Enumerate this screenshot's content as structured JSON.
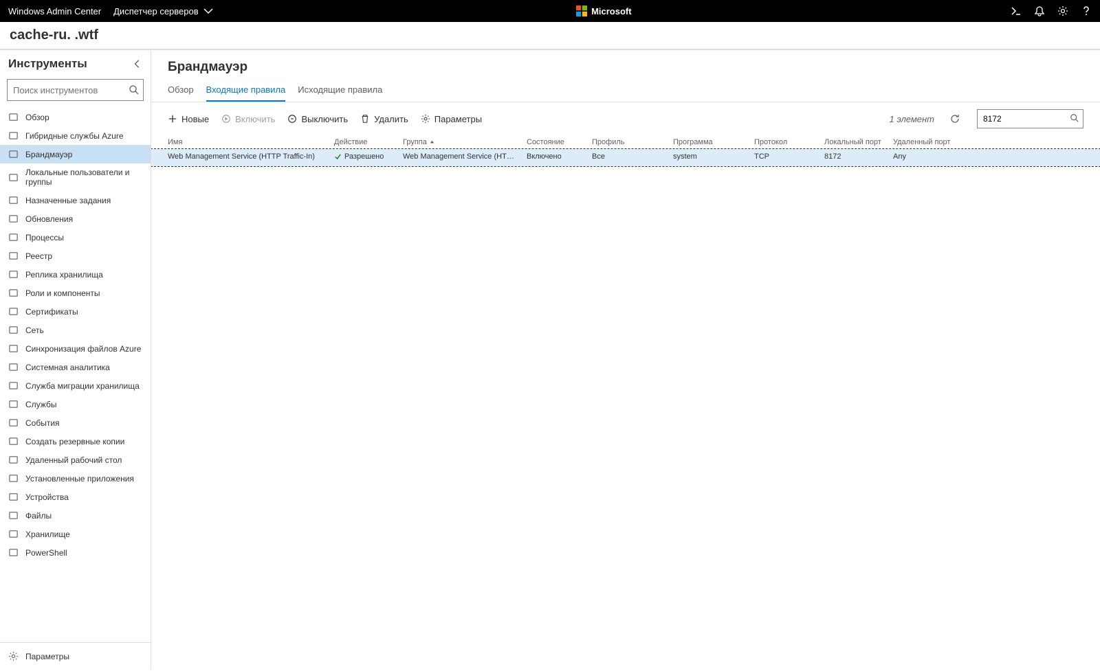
{
  "topbar": {
    "brand": "Windows Admin Center",
    "context": "Диспетчер серверов",
    "ms": "Microsoft"
  },
  "server": {
    "p1": "cache-ru.",
    "p2": "          ",
    "p3": ".wtf"
  },
  "sidebar": {
    "title": "Инструменты",
    "search_ph": "Поиск инструментов",
    "items": [
      {
        "label": "Обзор"
      },
      {
        "label": "Гибридные службы Azure"
      },
      {
        "label": "Брандмауэр"
      },
      {
        "label": "Локальные пользователи и группы"
      },
      {
        "label": "Назначенные задания"
      },
      {
        "label": "Обновления"
      },
      {
        "label": "Процессы"
      },
      {
        "label": "Реестр"
      },
      {
        "label": "Реплика хранилища"
      },
      {
        "label": "Роли и компоненты"
      },
      {
        "label": "Сертификаты"
      },
      {
        "label": "Сеть"
      },
      {
        "label": "Синхронизация файлов Azure"
      },
      {
        "label": "Системная аналитика"
      },
      {
        "label": "Служба миграции хранилища"
      },
      {
        "label": "Службы"
      },
      {
        "label": "События"
      },
      {
        "label": "Создать резервные копии"
      },
      {
        "label": "Удаленный рабочий стол"
      },
      {
        "label": "Установленные приложения"
      },
      {
        "label": "Устройства"
      },
      {
        "label": "Файлы"
      },
      {
        "label": "Хранилище"
      },
      {
        "label": "PowerShell"
      }
    ],
    "footer": {
      "label": "Параметры"
    }
  },
  "main": {
    "title": "Брандмауэр",
    "tabs": {
      "overview": "Обзор",
      "inbound": "Входящие правила",
      "outbound": "Исходящие правила"
    },
    "toolbar": {
      "new": "Новые",
      "enable": "Включить",
      "disable": "Выключить",
      "delete": "Удалить",
      "settings": "Параметры",
      "count": "1 элемент",
      "filter_value": "8172"
    },
    "columns": {
      "name": "Имя",
      "action": "Действие",
      "group": "Группа",
      "state": "Состояние",
      "profile": "Профиль",
      "program": "Программа",
      "protocol": "Протокол",
      "lport": "Локальный порт",
      "rport": "Удаленный порт"
    },
    "rows": [
      {
        "name": "Web Management Service (HTTP Traffic-In)",
        "action": "Разрешено",
        "group": "Web Management Service (HTTP)",
        "state": "Включено",
        "profile": "Все",
        "program": "system",
        "protocol": "TCP",
        "lport": "8172",
        "rport": "Any"
      }
    ]
  }
}
